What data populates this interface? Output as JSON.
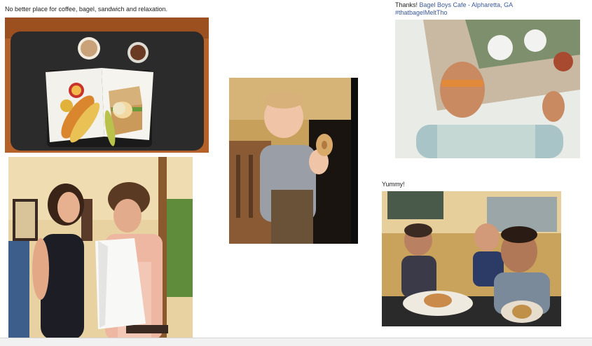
{
  "posts": [
    {
      "caption": "No better place for coffee, bagel, sandwich and relaxation.",
      "photo": "food-tray-photo"
    },
    {
      "caption": "",
      "photo": "couple-photo"
    },
    {
      "caption": "",
      "photo": "toddler-bagel-photo"
    },
    {
      "caption_prefix": "Thanks! ",
      "caption_link": "Bagel Boys Cafe - Alpharetta, GA",
      "hashtag": "#thatbagelMeltTho",
      "photo": "selfie-photo"
    },
    {
      "caption": "Yummy!",
      "photo": "kids-thumbsup-photo"
    }
  ],
  "colors": {
    "link": "#3b5998",
    "table_wood": "#b5622a",
    "mat": "#2b2b2b"
  }
}
